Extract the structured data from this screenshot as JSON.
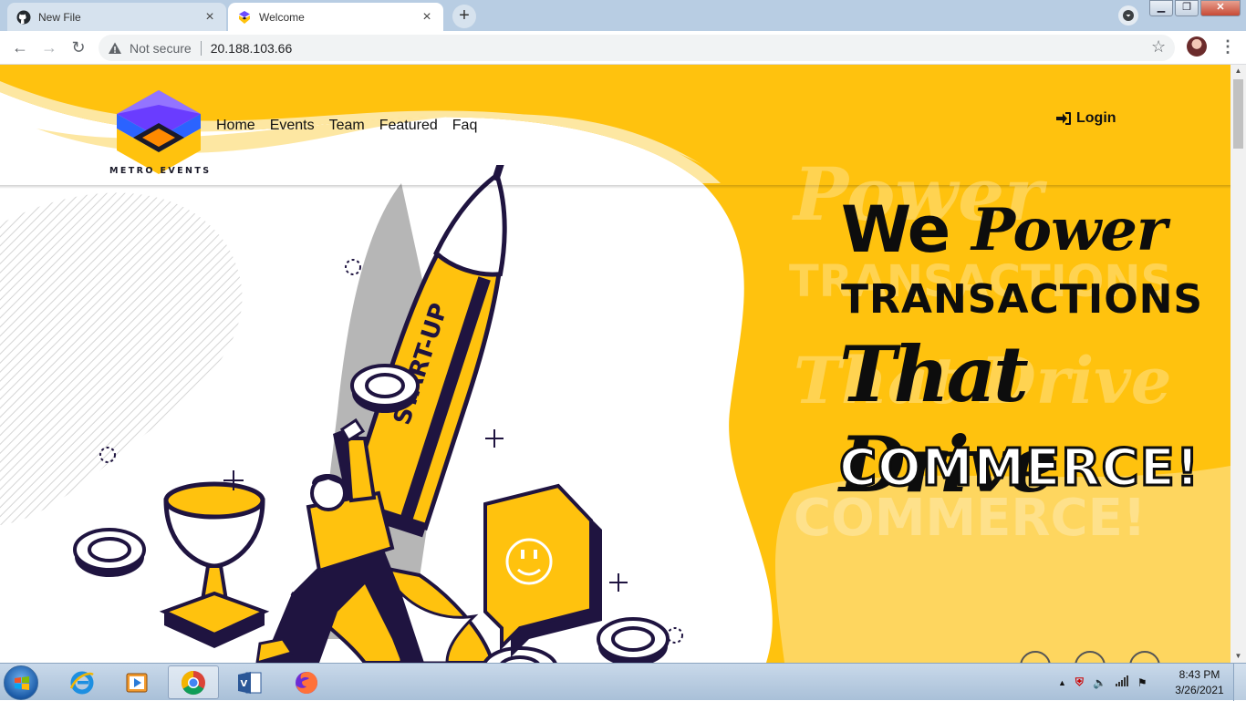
{
  "browser": {
    "tabs": [
      {
        "title": "New File",
        "icon": "github-icon",
        "active": false
      },
      {
        "title": "Welcome",
        "icon": "metro-events-favicon",
        "active": true
      }
    ],
    "new_tab_label": "+",
    "security_label": "Not secure",
    "url": "20.188.103.66"
  },
  "site": {
    "brand": "METRO EVENTS",
    "nav": [
      "Home",
      "Events",
      "Team",
      "Featured",
      "Faq"
    ],
    "login_label": "Login",
    "hero": {
      "line1a": "We",
      "line1b": "Power",
      "line2": "TRANSACTIONS",
      "line3": "That Drive",
      "line4": "COMMERCE!"
    },
    "illustration_label": "START-UP",
    "colors": {
      "accent": "#FFC20E",
      "light_accent": "#FDE7A2",
      "ink": "#1F1440"
    }
  },
  "taskbar": {
    "apps": [
      "internet-explorer-icon",
      "media-player-icon",
      "chrome-icon",
      "visio-icon",
      "firefox-icon"
    ],
    "time": "8:43 PM",
    "date": "3/26/2021"
  }
}
